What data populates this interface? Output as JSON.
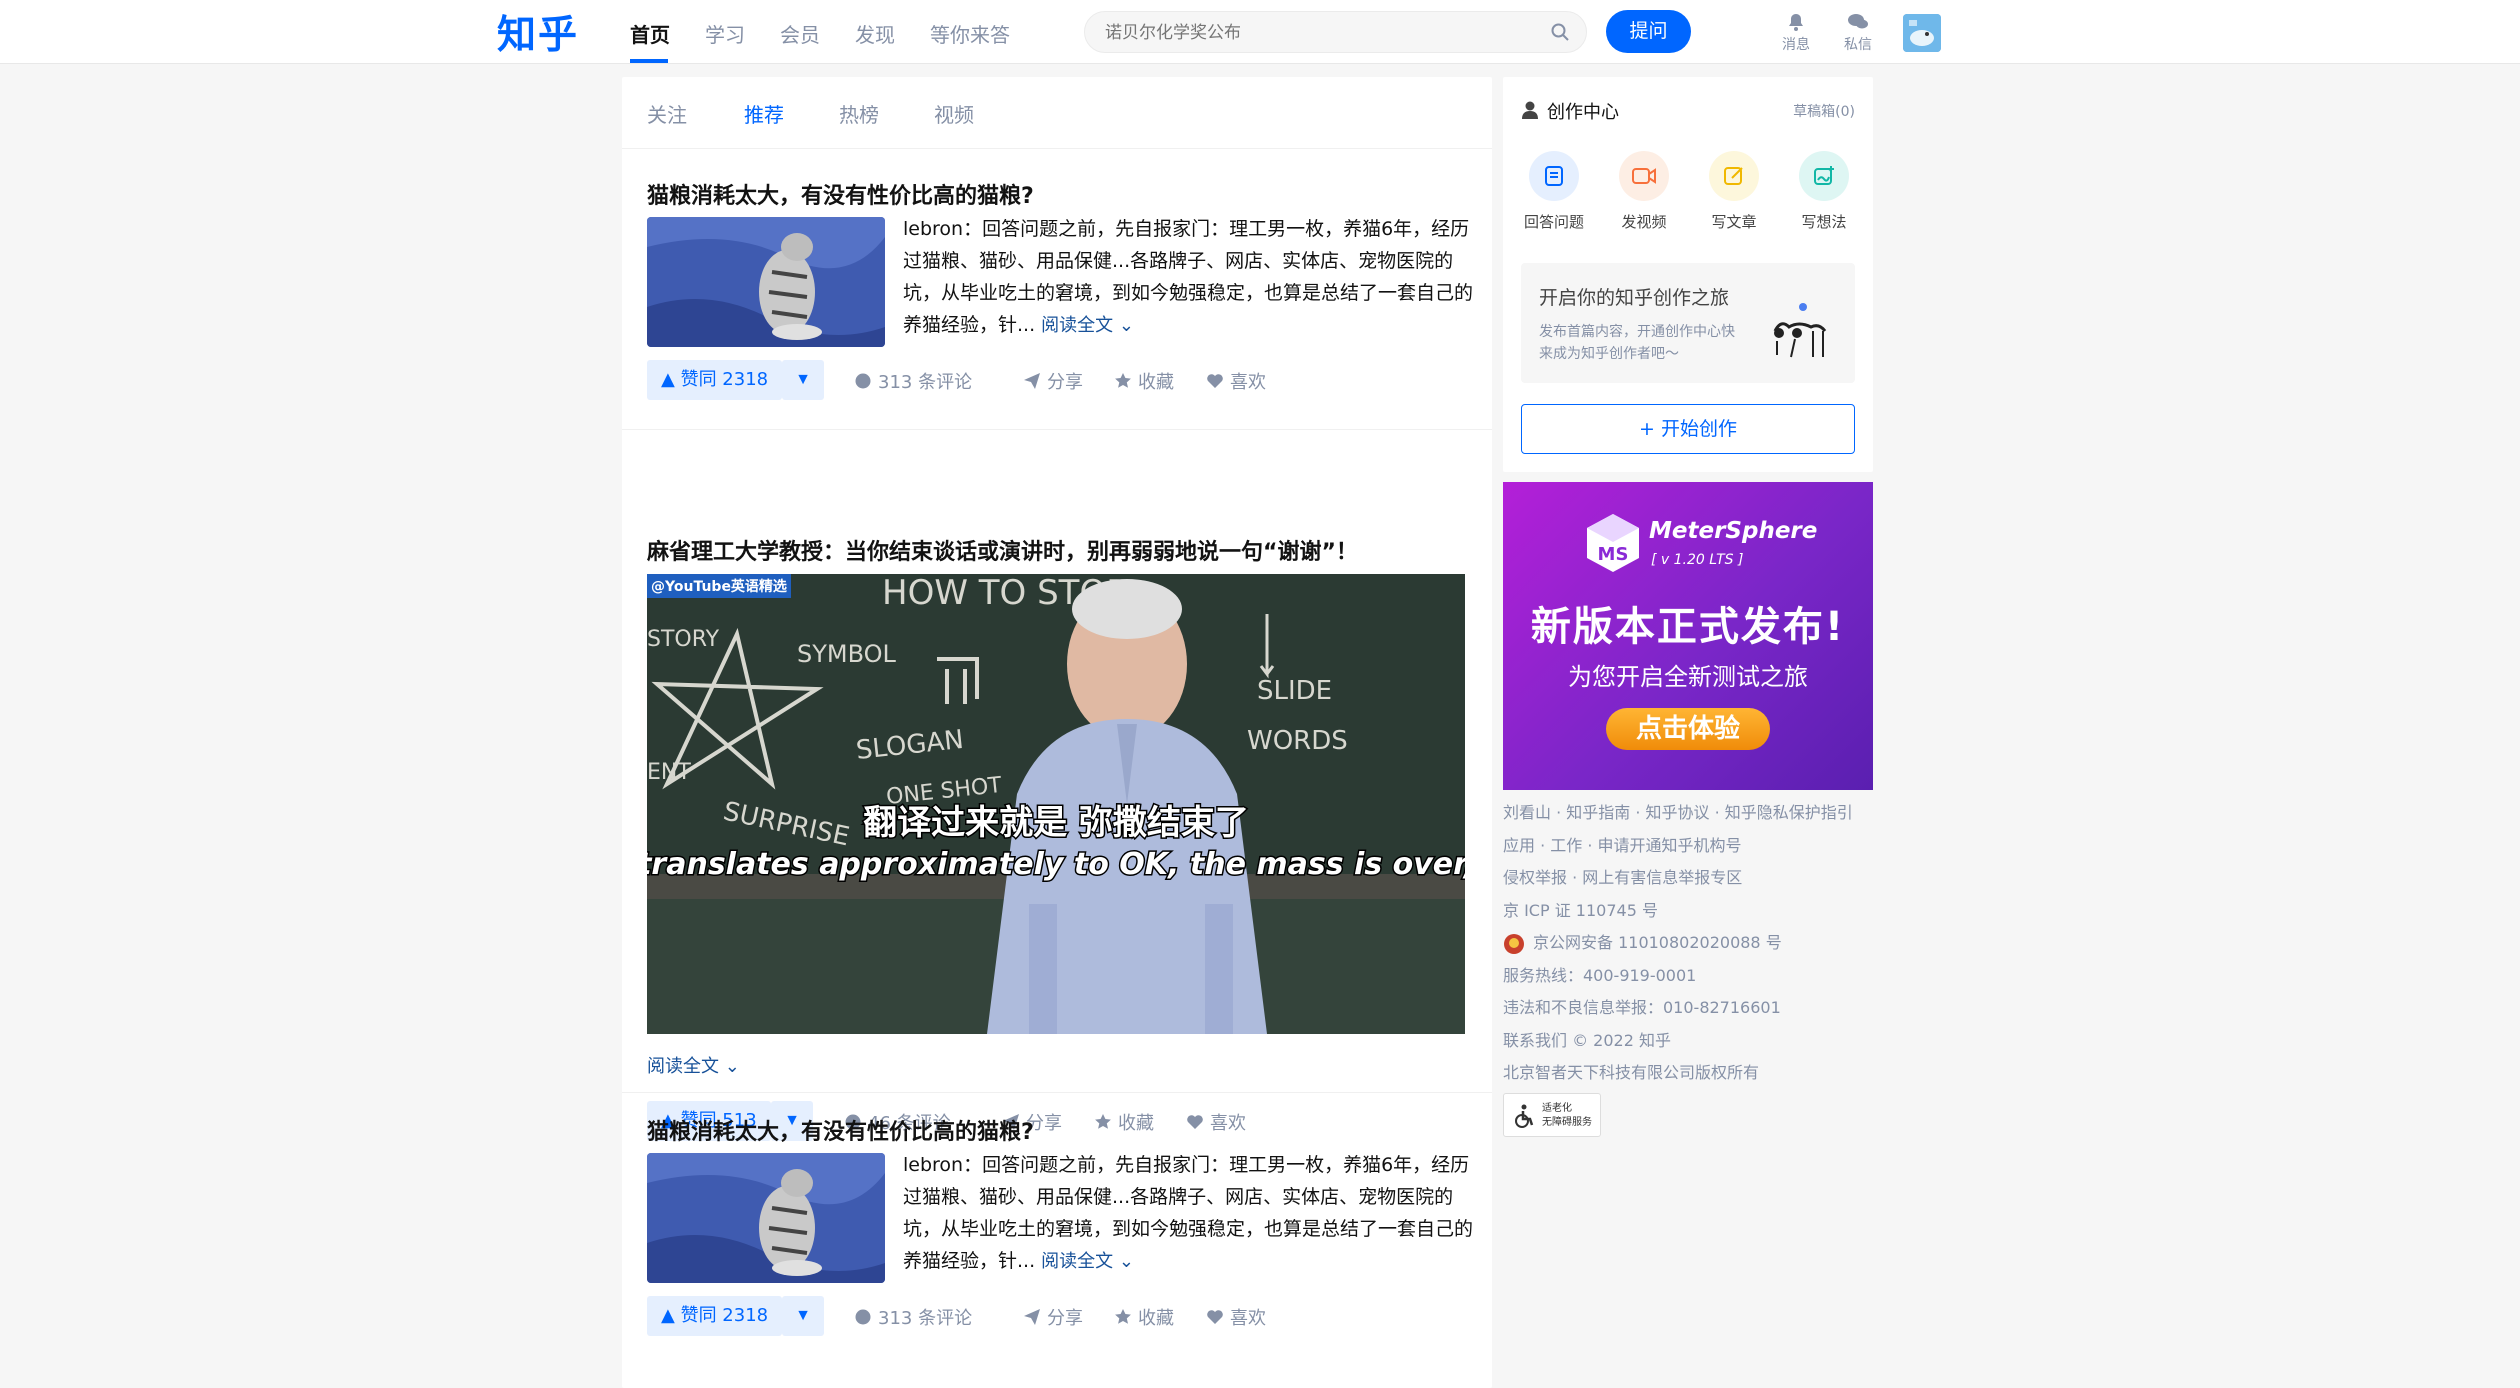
{
  "header": {
    "logo": "知乎",
    "nav": [
      "首页",
      "学习",
      "会员",
      "发现",
      "等你来答"
    ],
    "search_placeholder": "诺贝尔化学奖公布",
    "ask_label": "提问",
    "messages_label": "消息",
    "private_label": "私信"
  },
  "feed_tabs": [
    "关注",
    "推荐",
    "热榜",
    "视频"
  ],
  "feed": [
    {
      "title": "猫粮消耗太大，有没有性价比高的猫粮?",
      "excerpt": "lebron：回答问题之前，先自报家门：理工男一枚，养猫6年，经历过猫粮、猫砂、用品保健...各路牌子、网店、实体店、宠物医院的坑，从毕业吃土的窘境，到如今勉强稳定，也算是总结了一套自己的养猫经验，针...",
      "read_more": "阅读全文",
      "vote": "▲ 赞同 2318",
      "comments": "313 条评论",
      "share": "分享",
      "collect": "收藏",
      "like": "喜欢"
    },
    {
      "title": "麻省理工大学教授：当你结束谈话或演讲时，别再弱弱地说一句“谢谢”！",
      "video_tag": "@YouTube英语精选",
      "board_text": [
        "HOW TO STOP",
        "STORY",
        "SYMBOL",
        "SLOGAN",
        "ONE SHOT",
        "SURPRISE",
        "SLIDE",
        "WORDS",
        "ENT"
      ],
      "subtitle_cn": "翻译过来就是 弥撒结束了",
      "subtitle_en": "translates approximately to OK, the mass is over,",
      "read_more": "阅读全文",
      "vote": "▲ 赞同 513",
      "comments": "46 条评论",
      "share": "分享",
      "collect": "收藏",
      "like": "喜欢"
    },
    {
      "title": "猫粮消耗太大，有没有性价比高的猫粮?",
      "excerpt": "lebron：回答问题之前，先自报家门：理工男一枚，养猫6年，经历过猫粮、猫砂、用品保健...各路牌子、网店、实体店、宠物医院的坑，从毕业吃土的窘境，到如今勉强稳定，也算是总结了一套自己的养猫经验，针...",
      "read_more": "阅读全文",
      "vote": "▲ 赞同 2318",
      "comments": "313 条评论",
      "share": "分享",
      "collect": "收藏",
      "like": "喜欢"
    }
  ],
  "creator": {
    "title": "创作中心",
    "drafts": "草稿箱(0)",
    "tools": [
      "回答问题",
      "发视频",
      "写文章",
      "写想法"
    ],
    "promo_title": "开启你的知乎创作之旅",
    "promo_sub": "发布首篇内容，开通创作中心快来成为知乎创作者吧～",
    "start_button": "+ 开始创作"
  },
  "ad": {
    "logo_letters": "MS",
    "brand": "MeterSphere",
    "version": "[ v 1.20 LTS ]",
    "headline": "新版本正式发布!",
    "sub": "为您开启全新测试之旅",
    "cta": "点击体验"
  },
  "footer": [
    "刘看山 · 知乎指南 · 知乎协议 · 知乎隐私保护指引",
    "应用 · 工作 · 申请开通知乎机构号",
    "侵权举报 · 网上有害信息举报专区",
    "京 ICP 证 110745 号",
    "京公网安备 11010802020088 号",
    "服务热线：400-919-0001",
    "违法和不良信息举报：010-82716601",
    "联系我们 © 2022 知乎",
    "北京智者天下科技有限公司版权所有"
  ],
  "a11y_label": [
    "适老化",
    "无障碍服务"
  ]
}
